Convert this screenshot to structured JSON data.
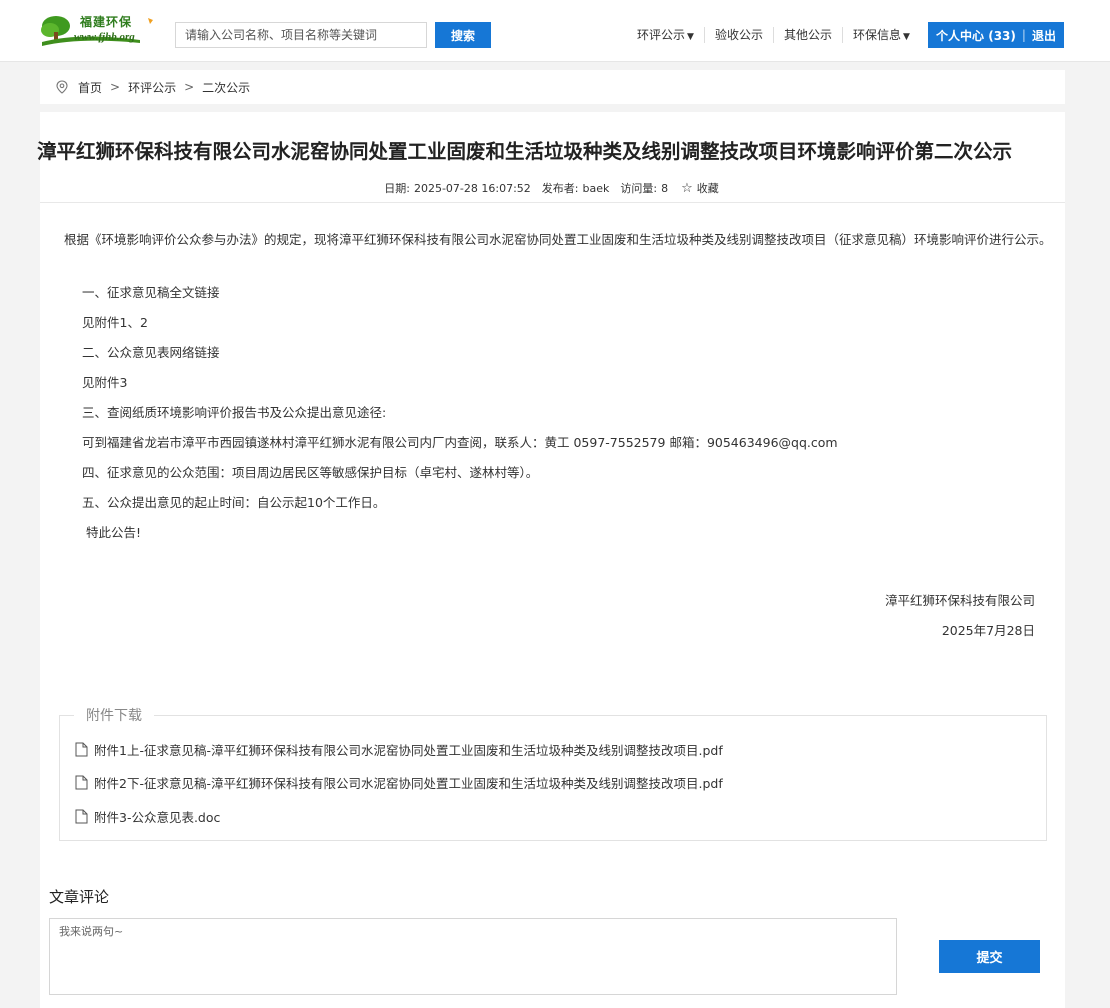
{
  "header": {
    "logo_title": "福建环保",
    "logo_url": "www.fjhb.org",
    "search_placeholder": "请输入公司名称、项目名称等关键词",
    "search_button": "搜索",
    "nav": [
      {
        "label": "环评公示",
        "dropdown": true
      },
      {
        "label": "验收公示",
        "dropdown": false
      },
      {
        "label": "其他公示",
        "dropdown": false
      },
      {
        "label": "环保信息",
        "dropdown": true
      }
    ],
    "user_center": "个人中心 (33)",
    "logout": "退出",
    "accent_color": "#1677d6"
  },
  "breadcrumb": [
    "首页",
    "环评公示",
    "二次公示"
  ],
  "article": {
    "title": "漳平红狮环保科技有限公司水泥窑协同处置工业固废和生活垃圾种类及线别调整技改项目环境影响评价第二次公示",
    "date_label": "日期:",
    "date": "2025-07-28 16:07:52",
    "publisher_label": "发布者:",
    "publisher": "baek",
    "views_label": "访问量:",
    "views": "8",
    "favorite": "收藏",
    "intro": "根据《环境影响评价公众参与办法》的规定，现将漳平红狮环保科技有限公司水泥窑协同处置工业固废和生活垃圾种类及线别调整技改项目（征求意见稿）环境影响评价进行公示。",
    "lines": [
      "一、征求意见稿全文链接",
      "见附件1、2",
      "二、公众意见表网络链接",
      "见附件3",
      "三、查阅纸质环境影响评价报告书及公众提出意见途径:",
      "可到福建省龙岩市漳平市西园镇遂林村漳平红狮水泥有限公司内厂内查阅，联系人：黄工 0597-7552579 邮箱：905463496@qq.com",
      "四、征求意见的公众范围：项目周边居民区等敏感保护目标（卓宅村、遂林村等）。",
      "五、公众提出意见的起止时间：自公示起10个工作日。",
      "特此公告!"
    ],
    "signature_company": "漳平红狮环保科技有限公司",
    "signature_date": "2025年7月28日"
  },
  "attachments": {
    "legend": "附件下载",
    "files": [
      "附件1上-征求意见稿-漳平红狮环保科技有限公司水泥窑协同处置工业固废和生活垃圾种类及线别调整技改项目.pdf",
      "附件2下-征求意见稿-漳平红狮环保科技有限公司水泥窑协同处置工业固废和生活垃圾种类及线别调整技改项目.pdf",
      "附件3-公众意见表.doc"
    ]
  },
  "comments": {
    "title": "文章评论",
    "placeholder": "我来说两句~",
    "submit": "提交"
  }
}
